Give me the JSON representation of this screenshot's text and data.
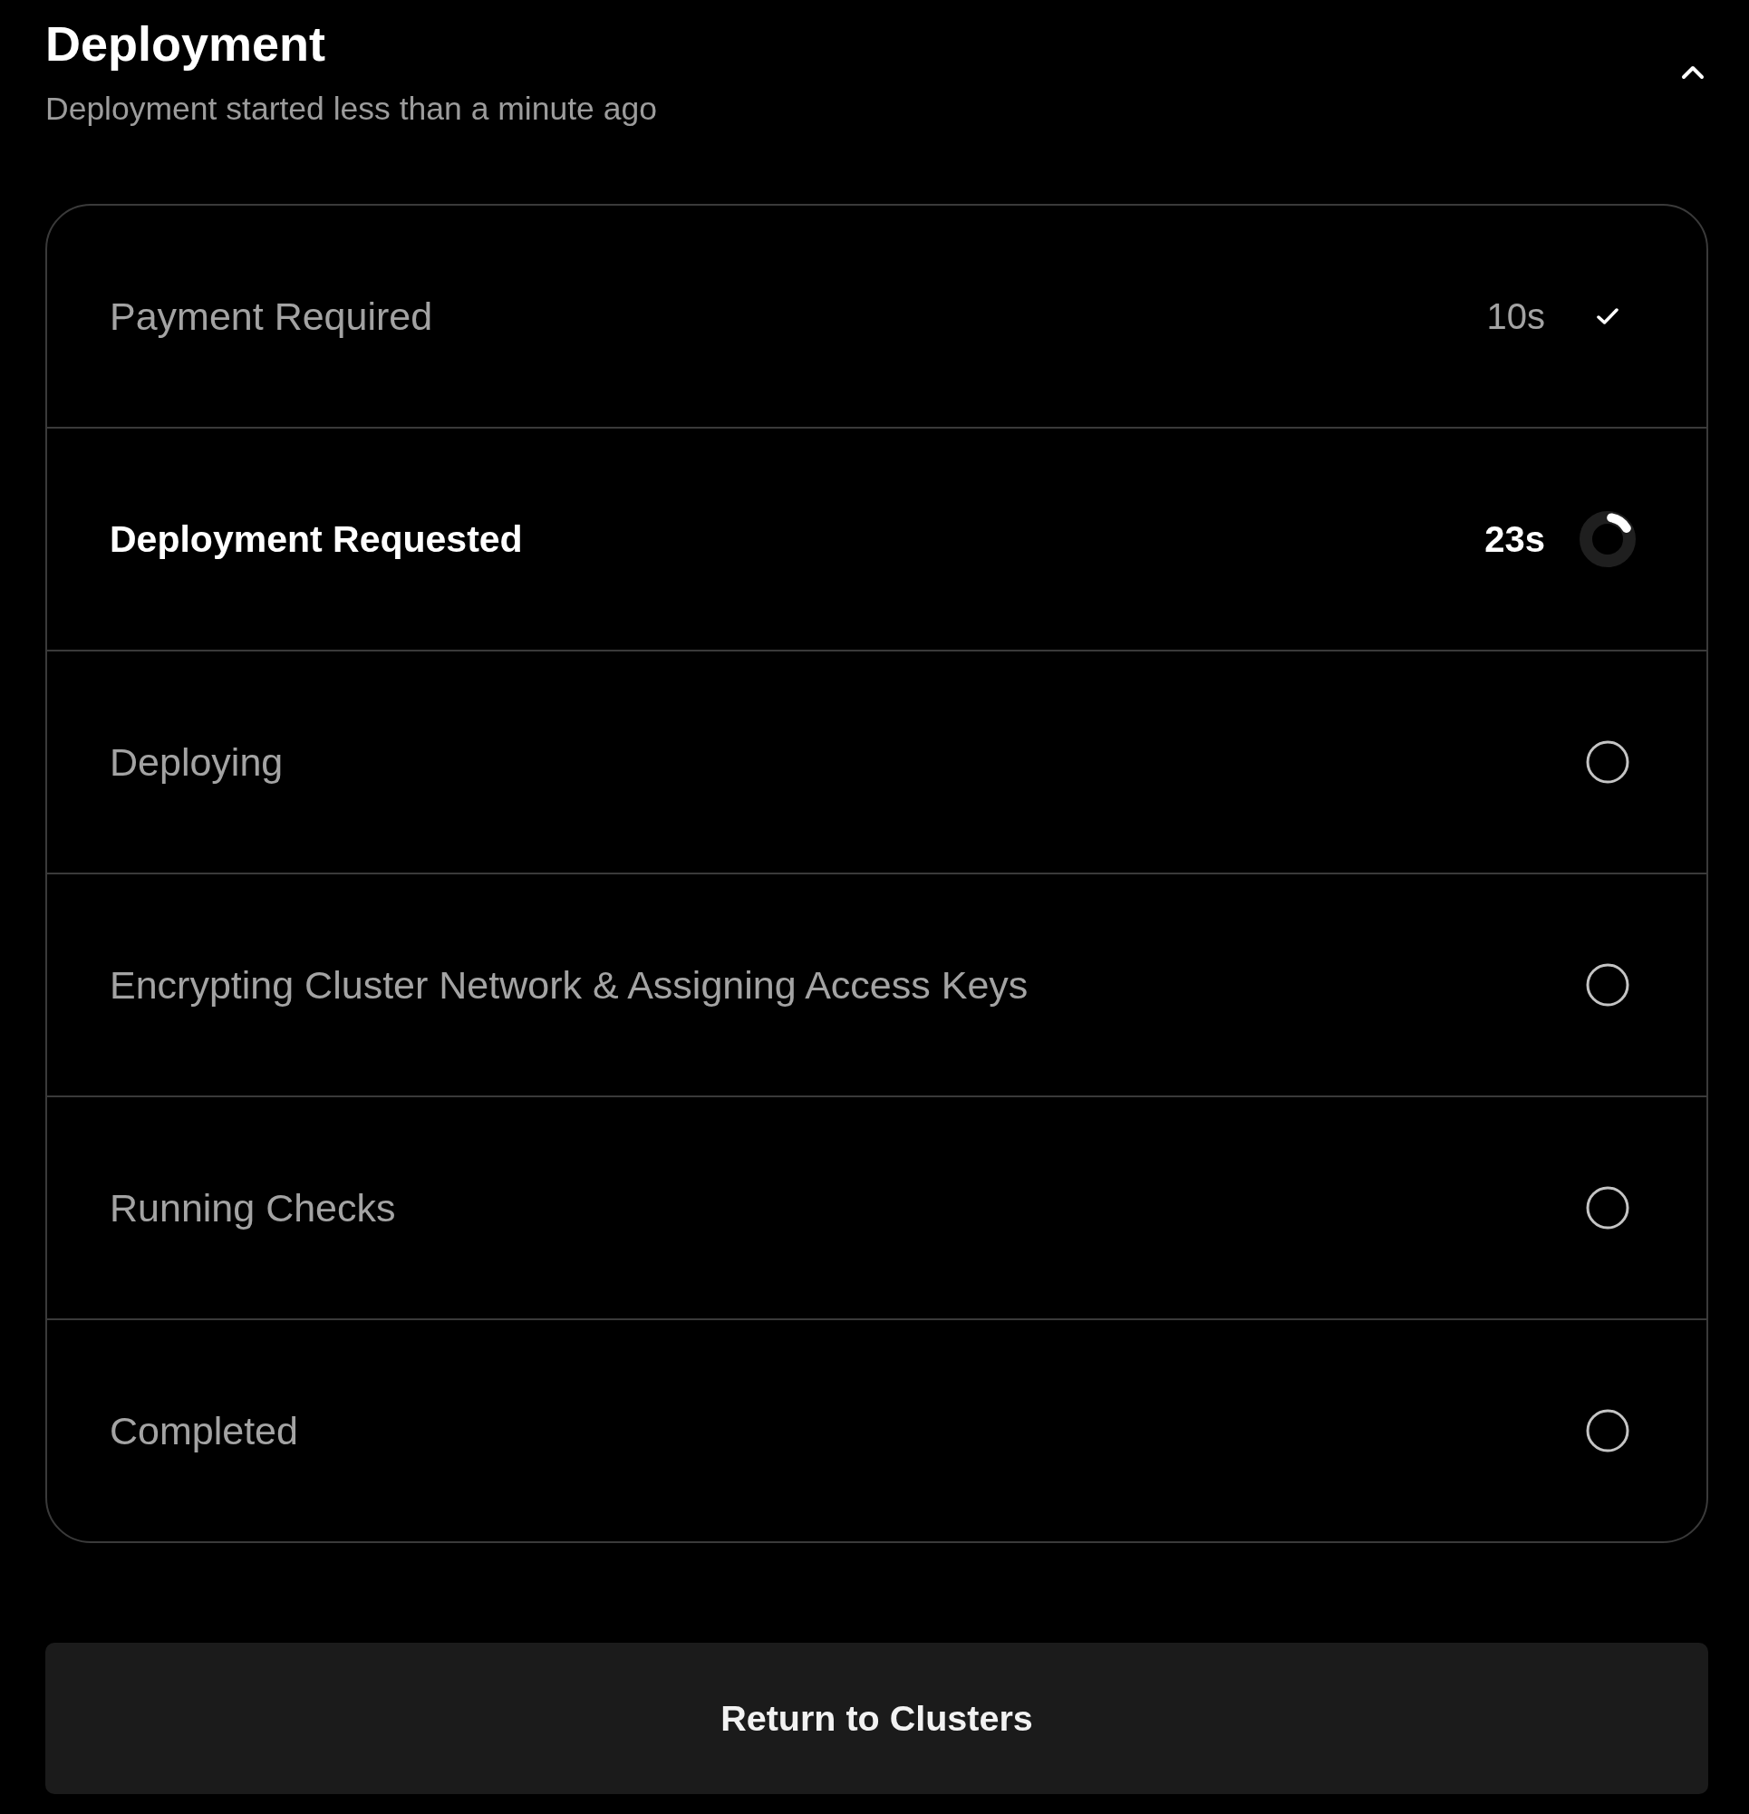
{
  "header": {
    "title": "Deployment",
    "subtitle": "Deployment started less than a minute ago",
    "expanded": true
  },
  "steps": [
    {
      "label": "Payment Required",
      "time": "10s",
      "kind": "done"
    },
    {
      "label": "Deployment Requested",
      "time": "23s",
      "kind": "active"
    },
    {
      "label": "Deploying",
      "kind": "pending"
    },
    {
      "label": "Encrypting Cluster Network & Assigning Access Keys",
      "kind": "pending"
    },
    {
      "label": "Running Checks",
      "kind": "pending"
    },
    {
      "label": "Completed",
      "kind": "pending"
    }
  ],
  "button": {
    "label": "Return to Clusters"
  }
}
